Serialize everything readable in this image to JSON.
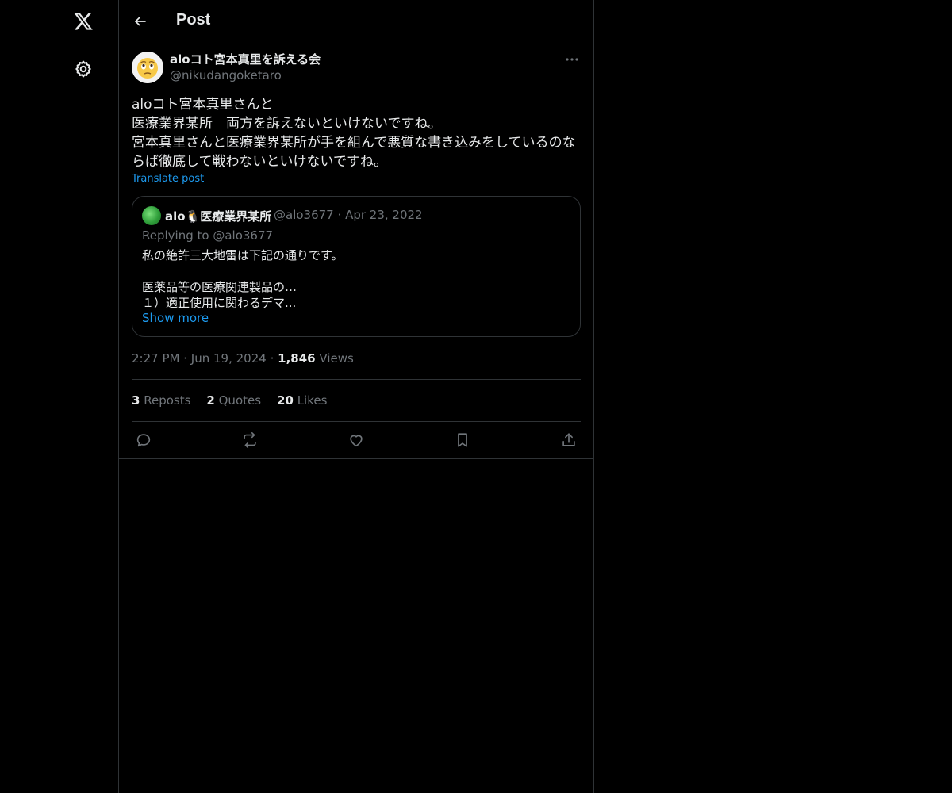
{
  "page": {
    "title": "Post"
  },
  "nav": {
    "logo_icon": "x-logo-icon",
    "settings_icon": "gear-icon"
  },
  "post": {
    "author_name": "aloコト宮本真里を訴える会",
    "author_handle": "@nikudangoketaro",
    "text_lines": [
      "aloコト宮本真里さんと",
      "医療業界某所　両方を訴えないといけないですね。",
      "宮本真里さんと医療業界某所が手を組んで悪質な書き込みをしているのな",
      "らば徹底して戦わないといけないですね。"
    ],
    "translate_label": "Translate post",
    "time": "2:27 PM",
    "date": "Jun 19, 2024",
    "views_count": "1,846",
    "views_label": "Views",
    "separator": "·"
  },
  "quote": {
    "author_name": "alo🐧医療業界某所",
    "author_handle": "@alo3677",
    "date": "Apr 23, 2022",
    "replying_to": "Replying to @alo3677",
    "text_lines": [
      "私の絶許三大地雷は下記の通りです。",
      "",
      "医薬品等の医療関連製品の…",
      "１）適正使用に関わるデマ..."
    ],
    "show_more": "Show more"
  },
  "stats": {
    "reposts_count": "3",
    "reposts_label": "Reposts",
    "quotes_count": "2",
    "quotes_label": "Quotes",
    "likes_count": "20",
    "likes_label": "Likes"
  },
  "colors": {
    "background": "#000000",
    "text": "#e7e9ea",
    "muted": "#71767b",
    "accent": "#1d9bf0",
    "border": "#2f3336"
  }
}
